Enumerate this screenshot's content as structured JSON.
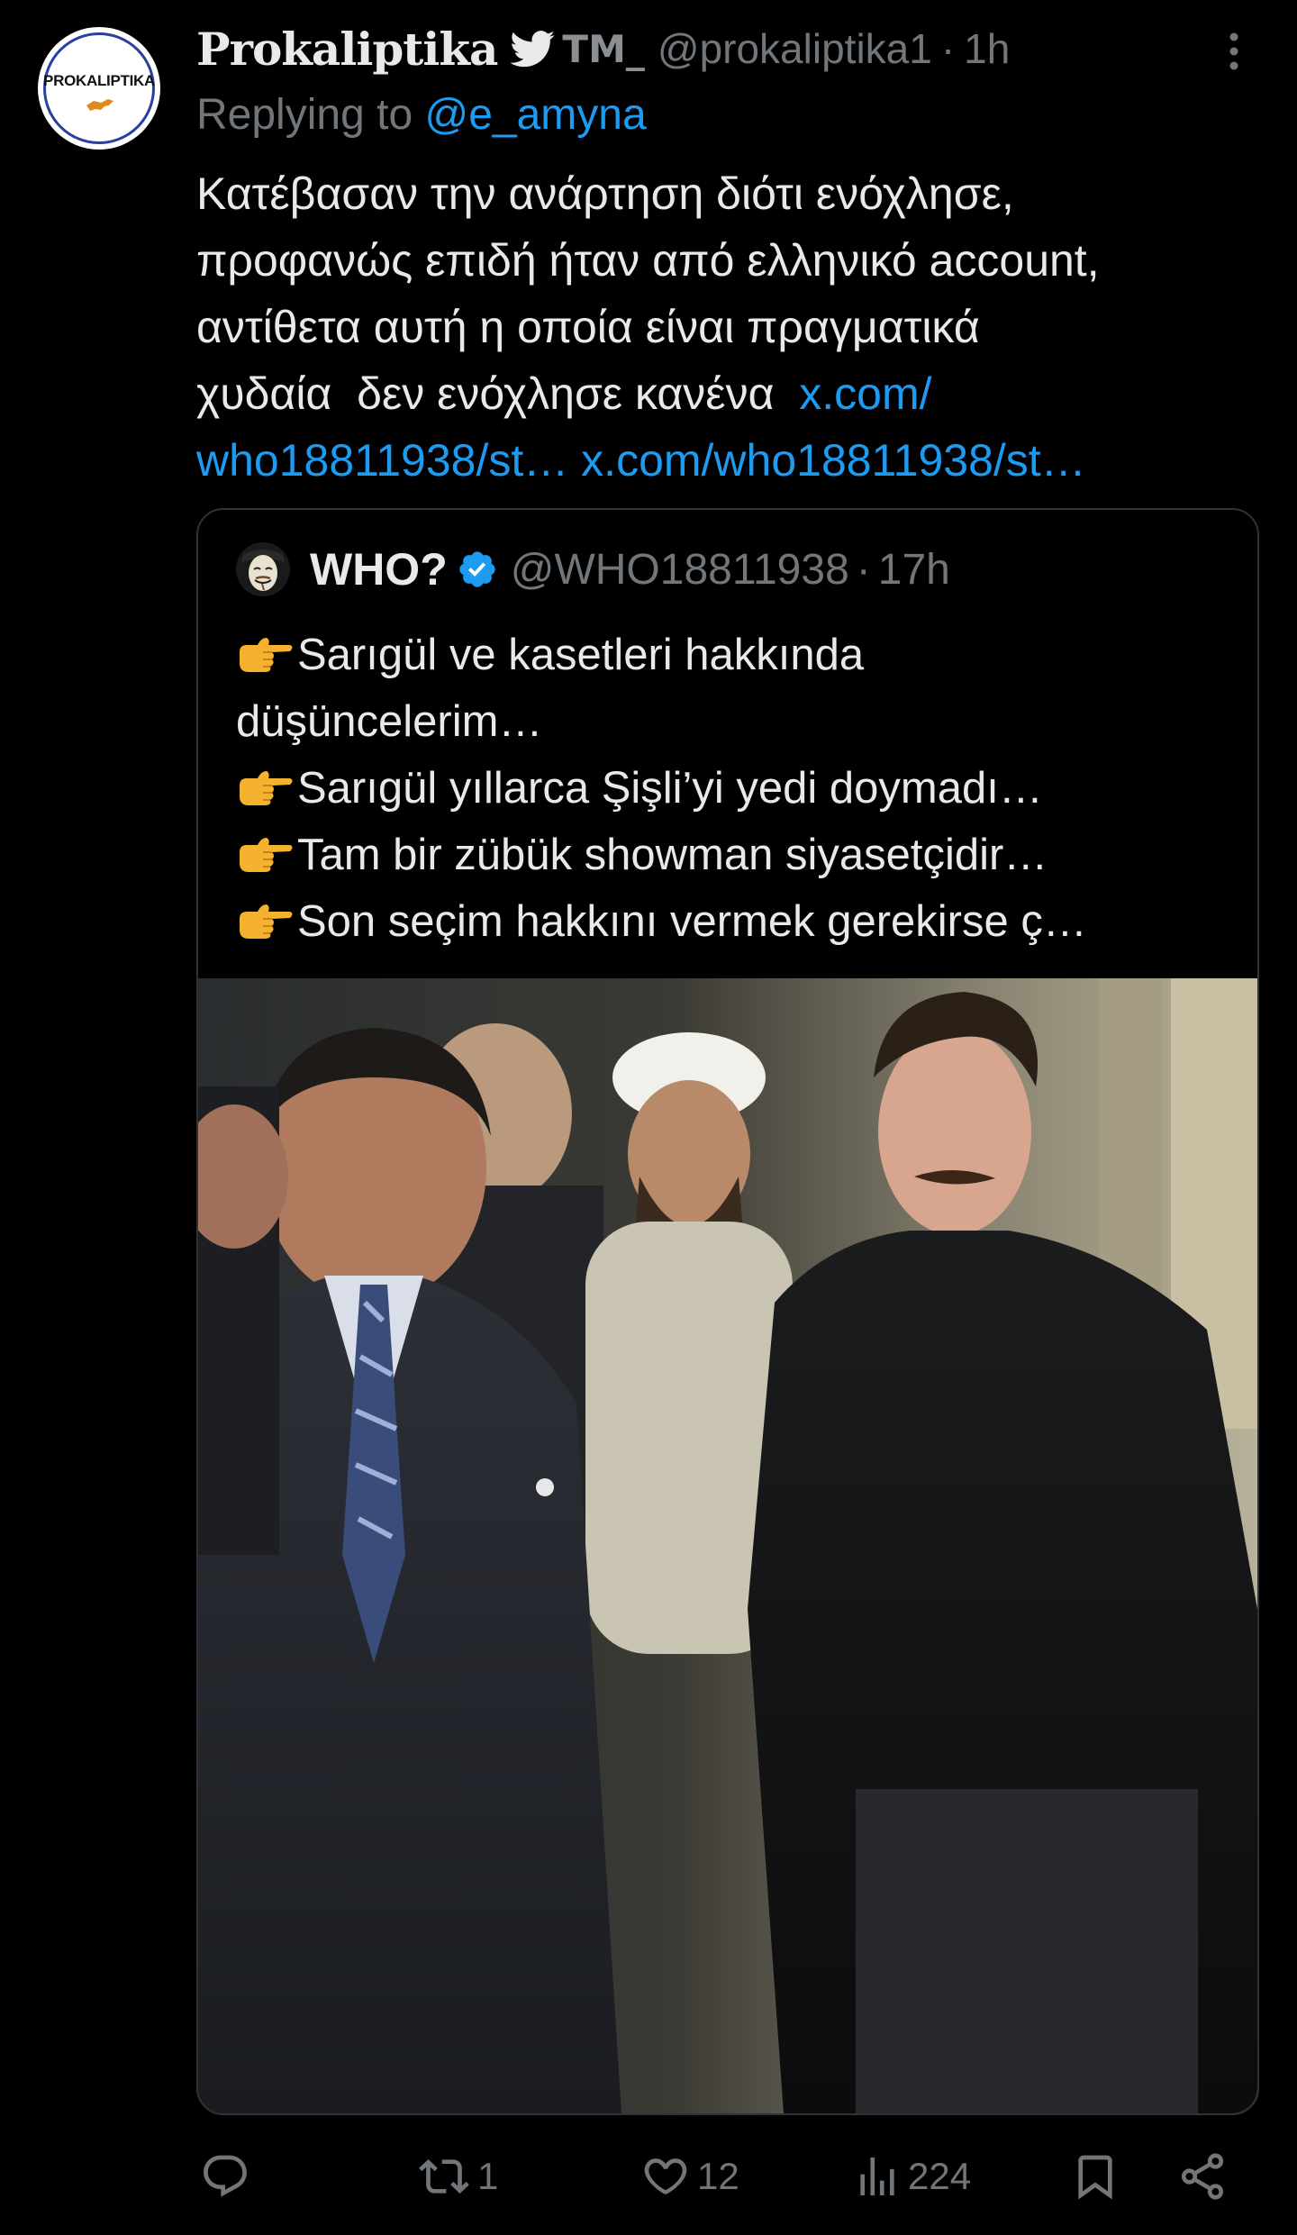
{
  "tweet": {
    "display_name": "Prokaliptika",
    "tm_suffix": "TM_",
    "handle": "@prokaliptika1",
    "separator": "·",
    "time": "1h",
    "avatar_text": "PROKALIPTIKA",
    "replying_prefix": "Replying to",
    "replying_to": "@e_amyna",
    "text_lines": [
      "Κατέβασαν την ανάρτηση  διότι ενόχλησε,",
      "προφανώς επιδή ήταν από ελληνικό account,",
      "αντίθετα αυτή η οποία είναι πραγματικά",
      "χυδαία  δεν ενόχλησε κανένα  "
    ],
    "link_1_part_a": "x.com/",
    "link_1_part_b": "who18811938/st…",
    "link_2": "x.com/who18811938/st…"
  },
  "quote": {
    "name": "WHO?",
    "handle": "@WHO18811938",
    "separator": "·",
    "time": "17h",
    "lines": [
      "Sarıgül ve kasetleri hakkında",
      "düşüncelerim…",
      "Sarıgül yıllarca Şişli’yi yedi doymadı…",
      "Tam bir zübük showman siyasetçidir…",
      "Son seçim hakkını vermek gerekirse ç…"
    ]
  },
  "actions": {
    "reply_icon": "reply-icon",
    "retweet_count": "1",
    "like_count": "12",
    "views_count": "224",
    "bookmark_icon": "bookmark-icon",
    "share_icon": "share-icon"
  },
  "colors": {
    "background": "#000000",
    "text": "#e7e9ea",
    "secondary": "#71767b",
    "link": "#1d9bf0",
    "border": "#2f3336",
    "verified": "#1d9bf0"
  }
}
